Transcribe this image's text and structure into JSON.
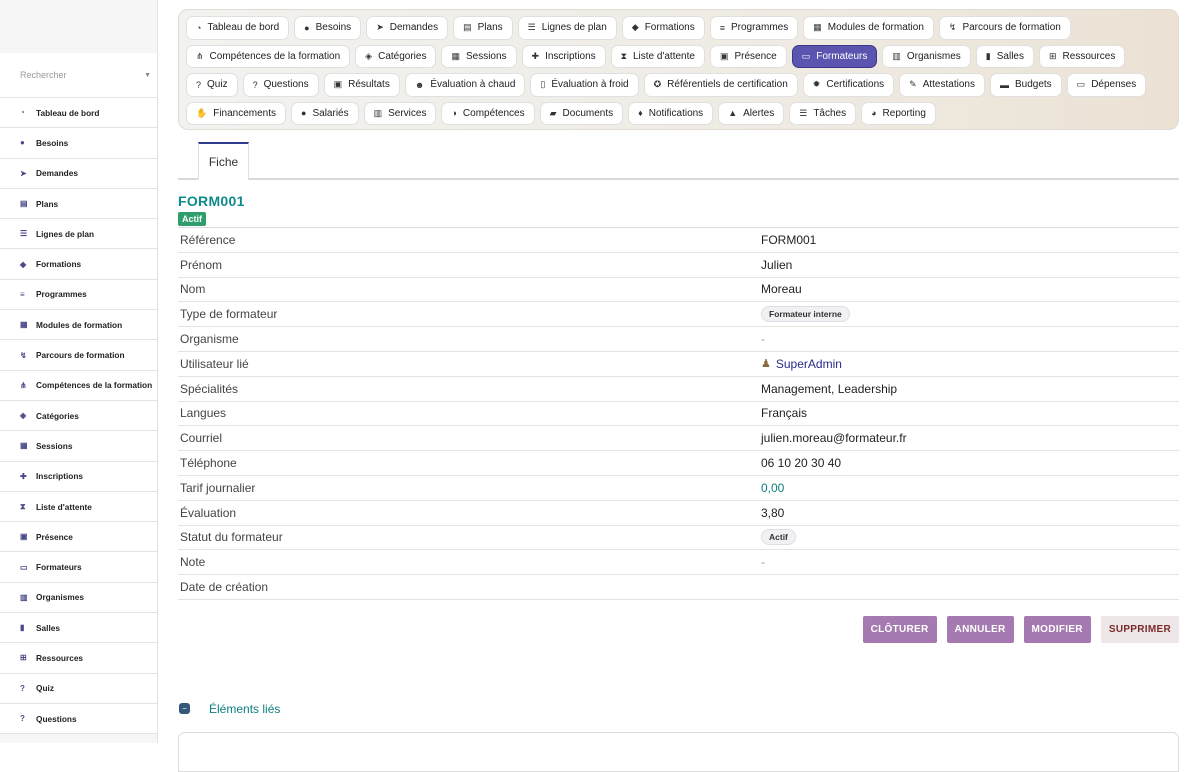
{
  "sidebar": {
    "search_placeholder": "Rechercher",
    "items": [
      {
        "label": "Tableau de bord",
        "icon": "dashboard-icon",
        "glyph": "◔"
      },
      {
        "label": "Besoins",
        "icon": "lightbulb-icon",
        "glyph": "●"
      },
      {
        "label": "Demandes",
        "icon": "paper-plane-icon",
        "glyph": "➤"
      },
      {
        "label": "Plans",
        "icon": "clipboard-icon",
        "glyph": "▤"
      },
      {
        "label": "Lignes de plan",
        "icon": "list-icon",
        "glyph": "☰"
      },
      {
        "label": "Formations",
        "icon": "graduation-cap-icon",
        "glyph": "◆"
      },
      {
        "label": "Programmes",
        "icon": "bars-icon",
        "glyph": "≡"
      },
      {
        "label": "Modules de formation",
        "icon": "cubes-icon",
        "glyph": "▦"
      },
      {
        "label": "Parcours de formation",
        "icon": "route-icon",
        "glyph": "↯"
      },
      {
        "label": "Compétences de la formation",
        "icon": "sitemap-icon",
        "glyph": "⋔"
      },
      {
        "label": "Catégories",
        "icon": "tags-icon",
        "glyph": "◈"
      },
      {
        "label": "Sessions",
        "icon": "calendar-icon",
        "glyph": "▦"
      },
      {
        "label": "Inscriptions",
        "icon": "user-plus-icon",
        "glyph": "✚"
      },
      {
        "label": "Liste d'attente",
        "icon": "hourglass-icon",
        "glyph": "⧗"
      },
      {
        "label": "Présence",
        "icon": "clipboard-check-icon",
        "glyph": "▣"
      },
      {
        "label": "Formateurs",
        "icon": "chalkboard-teacher-icon",
        "glyph": "▭"
      },
      {
        "label": "Organismes",
        "icon": "building-icon",
        "glyph": "▥"
      },
      {
        "label": "Salles",
        "icon": "door-icon",
        "glyph": "▮"
      },
      {
        "label": "Ressources",
        "icon": "network-icon",
        "glyph": "⊞"
      },
      {
        "label": "Quiz",
        "icon": "question-circle-icon",
        "glyph": "?"
      },
      {
        "label": "Questions",
        "icon": "question-icon",
        "glyph": "?"
      }
    ]
  },
  "topnav": {
    "items": [
      {
        "label": "Tableau de bord",
        "icon": "dashboard-icon",
        "glyph": "◔",
        "active": false
      },
      {
        "label": "Besoins",
        "icon": "lightbulb-icon",
        "glyph": "●",
        "active": false
      },
      {
        "label": "Demandes",
        "icon": "paper-plane-icon",
        "glyph": "➤",
        "active": false
      },
      {
        "label": "Plans",
        "icon": "clipboard-icon",
        "glyph": "▤",
        "active": false
      },
      {
        "label": "Lignes de plan",
        "icon": "list-icon",
        "glyph": "☰",
        "active": false
      },
      {
        "label": "Formations",
        "icon": "graduation-cap-icon",
        "glyph": "◆",
        "active": false
      },
      {
        "label": "Programmes",
        "icon": "bars-icon",
        "glyph": "≡",
        "active": false
      },
      {
        "label": "Modules de formation",
        "icon": "cubes-icon",
        "glyph": "▦",
        "active": false
      },
      {
        "label": "Parcours de formation",
        "icon": "route-icon",
        "glyph": "↯",
        "active": false
      },
      {
        "label": "Compétences de la formation",
        "icon": "sitemap-icon",
        "glyph": "⋔",
        "active": false
      },
      {
        "label": "Catégories",
        "icon": "tags-icon",
        "glyph": "◈",
        "active": false
      },
      {
        "label": "Sessions",
        "icon": "calendar-icon",
        "glyph": "▦",
        "active": false
      },
      {
        "label": "Inscriptions",
        "icon": "user-plus-icon",
        "glyph": "✚",
        "active": false
      },
      {
        "label": "Liste d'attente",
        "icon": "hourglass-icon",
        "glyph": "⧗",
        "active": false
      },
      {
        "label": "Présence",
        "icon": "clipboard-check-icon",
        "glyph": "▣",
        "active": false
      },
      {
        "label": "Formateurs",
        "icon": "chalkboard-teacher-icon",
        "glyph": "▭",
        "active": true
      },
      {
        "label": "Organismes",
        "icon": "building-icon",
        "glyph": "▥",
        "active": false
      },
      {
        "label": "Salles",
        "icon": "door-icon",
        "glyph": "▮",
        "active": false
      },
      {
        "label": "Ressources",
        "icon": "network-icon",
        "glyph": "⊞",
        "active": false
      },
      {
        "label": "Quiz",
        "icon": "question-circle-icon",
        "glyph": "?",
        "active": false
      },
      {
        "label": "Questions",
        "icon": "question-icon",
        "glyph": "?",
        "active": false
      },
      {
        "label": "Résultats",
        "icon": "poll-icon",
        "glyph": "▣",
        "active": false
      },
      {
        "label": "Évaluation à chaud",
        "icon": "smile-icon",
        "glyph": "☻",
        "active": false
      },
      {
        "label": "Évaluation à froid",
        "icon": "thermometer-icon",
        "glyph": "▯",
        "active": false
      },
      {
        "label": "Référentiels de certification",
        "icon": "certificate-icon",
        "glyph": "✪",
        "active": false
      },
      {
        "label": "Certifications",
        "icon": "badge-icon",
        "glyph": "✹",
        "active": false
      },
      {
        "label": "Attestations",
        "icon": "file-signature-icon",
        "glyph": "✎",
        "active": false
      },
      {
        "label": "Budgets",
        "icon": "wallet-icon",
        "glyph": "▬",
        "active": false
      },
      {
        "label": "Dépenses",
        "icon": "money-bill-icon",
        "glyph": "▭",
        "active": false
      },
      {
        "label": "Financements",
        "icon": "hand-holding-dollar-icon",
        "glyph": "✋",
        "active": false
      },
      {
        "label": "Salariés",
        "icon": "user-tie-icon",
        "glyph": "●",
        "active": false
      },
      {
        "label": "Services",
        "icon": "building-columns-icon",
        "glyph": "▥",
        "active": false
      },
      {
        "label": "Compétences",
        "icon": "brain-icon",
        "glyph": "◑",
        "active": false
      },
      {
        "label": "Documents",
        "icon": "folder-open-icon",
        "glyph": "▰",
        "active": false
      },
      {
        "label": "Notifications",
        "icon": "bell-icon",
        "glyph": "♦",
        "active": false
      },
      {
        "label": "Alertes",
        "icon": "warning-icon",
        "glyph": "▲",
        "active": false
      },
      {
        "label": "Tâches",
        "icon": "tasks-icon",
        "glyph": "☰",
        "active": false
      },
      {
        "label": "Reporting",
        "icon": "chart-pie-icon",
        "glyph": "◕",
        "active": false
      }
    ]
  },
  "tabs": {
    "fiche": "Fiche"
  },
  "record": {
    "title": "FORM001",
    "status_badge": "Actif",
    "fields": [
      {
        "label": "Référence",
        "value": "FORM001",
        "kind": "text"
      },
      {
        "label": "Prénom",
        "value": "Julien",
        "kind": "text"
      },
      {
        "label": "Nom",
        "value": "Moreau",
        "kind": "text"
      },
      {
        "label": "Type de formateur",
        "value": "Formateur interne",
        "kind": "pill"
      },
      {
        "label": "Organisme",
        "value": "-",
        "kind": "muted"
      },
      {
        "label": "Utilisateur lié",
        "value": "SuperAdmin",
        "kind": "user"
      },
      {
        "label": "Spécialités",
        "value": "Management, Leadership",
        "kind": "text"
      },
      {
        "label": "Langues",
        "value": "Français",
        "kind": "text"
      },
      {
        "label": "Courriel",
        "value": "julien.moreau@formateur.fr",
        "kind": "text"
      },
      {
        "label": "Téléphone",
        "value": "06 10 20 30 40",
        "kind": "text"
      },
      {
        "label": "Tarif journalier",
        "value": "0,00",
        "kind": "teal"
      },
      {
        "label": "Évaluation",
        "value": "3,80",
        "kind": "text"
      },
      {
        "label": "Statut du formateur",
        "value": "Actif",
        "kind": "pill"
      },
      {
        "label": "Note",
        "value": "-",
        "kind": "muted"
      },
      {
        "label": "Date de création",
        "value": "",
        "kind": "text"
      }
    ]
  },
  "actions": {
    "close": "CLÔTURER",
    "cancel": "ANNULER",
    "edit": "MODIFIER",
    "delete": "SUPPRIMER"
  },
  "linked": {
    "title": "Éléments liés"
  },
  "colors": {
    "accent": "#5c55b0",
    "title_teal": "#0f8a8a",
    "success": "#2e9e6a",
    "action_purple": "#a57ab0"
  }
}
